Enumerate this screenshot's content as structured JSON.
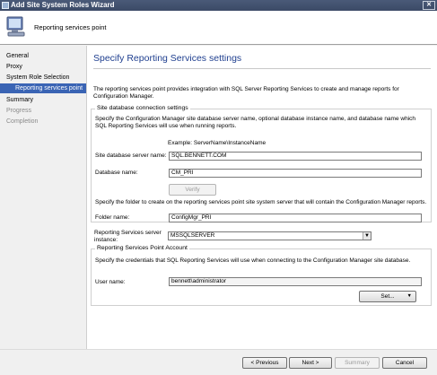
{
  "window": {
    "title": "Add Site System Roles Wizard",
    "close_glyph": "✕"
  },
  "header": {
    "title": "Reporting services point"
  },
  "sidebar": {
    "items": [
      {
        "label": "General",
        "state": "normal"
      },
      {
        "label": "Proxy",
        "state": "normal"
      },
      {
        "label": "System Role Selection",
        "state": "normal"
      },
      {
        "label": "Reporting services point",
        "state": "selected"
      },
      {
        "label": "Summary",
        "state": "normal"
      },
      {
        "label": "Progress",
        "state": "disabled"
      },
      {
        "label": "Completion",
        "state": "disabled"
      }
    ]
  },
  "main": {
    "title": "Specify Reporting Services settings",
    "intro": "The reporting services point provides integration with SQL Server Reporting Services to create and manage reports for Configuration Manager.",
    "db_group": {
      "title": "Site database connection settings",
      "description": "Specify the Configuration Manager site database server name, optional database instance name, and database name which SQL Reporting Services will use when running reports.",
      "example": "Example: ServerName\\InstanceName",
      "server_label": "Site database server name:",
      "server_value": "SQL.BENNETT.COM",
      "dbname_label": "Database name:",
      "dbname_value": "CM_PRI",
      "verify_label": "Verify"
    },
    "folder_description": "Specify the folder to create on the reporting services point site system server that will contain the Configuration Manager reports.",
    "folder_label": "Folder name:",
    "folder_value": "ConfigMgr_PRI",
    "instance_label": "Reporting Services server instance:",
    "instance_value": "MSSQLSERVER",
    "account_group": {
      "title": "Reporting Services Point Account",
      "description": "Specify the credentials that SQL Reporting Services will use when connecting to the Configuration Manager site database.",
      "user_label": "User name:",
      "user_value": "bennett\\administrator",
      "set_label": "Set..."
    }
  },
  "footer": {
    "previous_label": "< Previous",
    "next_label": "Next >",
    "summary_label": "Summary",
    "cancel_label": "Cancel"
  }
}
